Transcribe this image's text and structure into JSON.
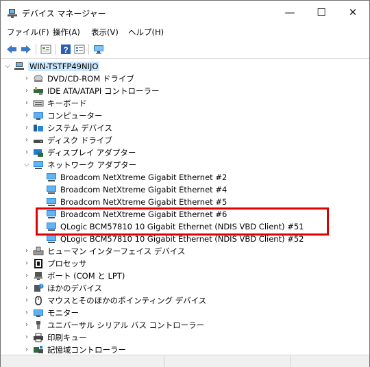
{
  "window": {
    "title": "デバイス マネージャー",
    "minimize": "—",
    "maximize": "☐",
    "close": "✕"
  },
  "menu": [
    "ファイル(F)",
    "操作(A)",
    "表示(V)",
    "ヘルプ(H)"
  ],
  "toolbar": {
    "icons": [
      "back-arrow-icon",
      "forward-arrow-icon",
      "properties-icon",
      "help-icon",
      "view-icon",
      "monitor-icon"
    ]
  },
  "tree": {
    "root": "WIN-TSTFP49NIJO",
    "categories": [
      {
        "label": "DVD/CD-ROM ドライブ",
        "icon": "dvd-drive-icon",
        "expanded": false
      },
      {
        "label": "IDE ATA/ATAPI コントローラー",
        "icon": "ide-controller-icon",
        "expanded": false
      },
      {
        "label": "キーボード",
        "icon": "keyboard-icon",
        "expanded": false
      },
      {
        "label": "コンピューター",
        "icon": "computer-icon",
        "expanded": false
      },
      {
        "label": "システム デバイス",
        "icon": "system-device-icon",
        "expanded": false
      },
      {
        "label": "ディスク ドライブ",
        "icon": "disk-drive-icon",
        "expanded": false
      },
      {
        "label": "ディスプレイ アダプター",
        "icon": "display-adapter-icon",
        "expanded": false
      },
      {
        "label": "ネットワーク アダプター",
        "icon": "network-adapter-icon",
        "expanded": true,
        "children": [
          "Broadcom NetXtreme Gigabit Ethernet #2",
          "Broadcom NetXtreme Gigabit Ethernet #4",
          "Broadcom NetXtreme Gigabit Ethernet #5",
          "Broadcom NetXtreme Gigabit Ethernet #6",
          "QLogic BCM57810 10 Gigabit Ethernet (NDIS VBD Client) #51",
          "QLogic BCM57810 10 Gigabit Ethernet (NDIS VBD Client) #52"
        ]
      },
      {
        "label": "ヒューマン インターフェイス デバイス",
        "icon": "hid-icon",
        "expanded": false
      },
      {
        "label": "プロセッサ",
        "icon": "processor-icon",
        "expanded": false
      },
      {
        "label": "ポート (COM と LPT)",
        "icon": "port-icon",
        "expanded": false
      },
      {
        "label": "ほかのデバイス",
        "icon": "other-device-icon",
        "expanded": false
      },
      {
        "label": "マウスとそのほかのポインティング デバイス",
        "icon": "mouse-icon",
        "expanded": false
      },
      {
        "label": "モニター",
        "icon": "monitor-icon",
        "expanded": false
      },
      {
        "label": "ユニバーサル シリアル バス コントローラー",
        "icon": "usb-icon",
        "expanded": false
      },
      {
        "label": "印刷キュー",
        "icon": "print-queue-icon",
        "expanded": false
      },
      {
        "label": "記憶域コントローラー",
        "icon": "storage-controller-icon",
        "expanded": false
      }
    ]
  },
  "colors": {
    "highlight_border": "#e00000",
    "selection": "#cce8ff",
    "network_icon": "#1e7fd6"
  }
}
